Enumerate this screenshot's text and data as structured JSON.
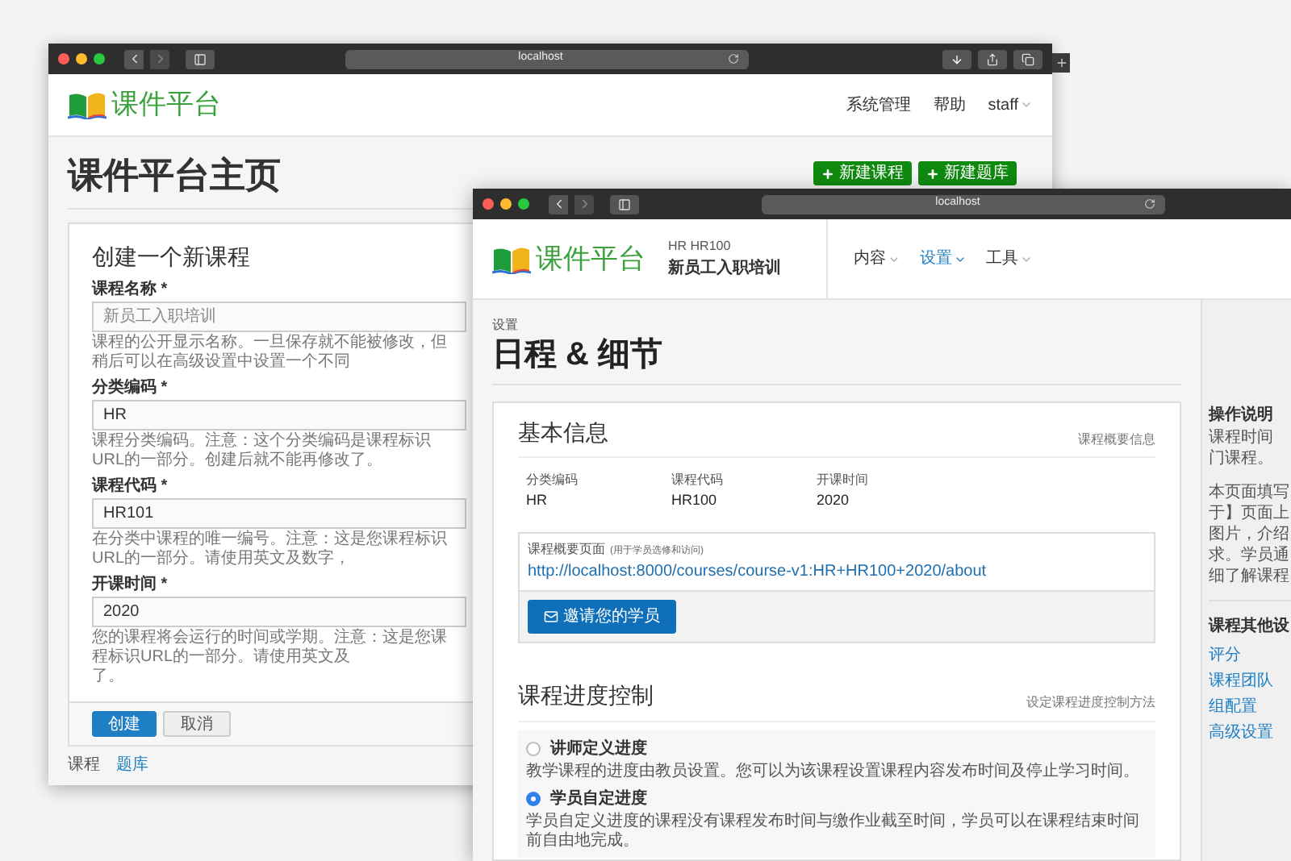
{
  "back_window": {
    "address": "localhost",
    "logo_text": "课件平台",
    "nav": [
      {
        "label": "系统管理",
        "kind": "link"
      },
      {
        "label": "帮助",
        "kind": "link"
      },
      {
        "label": "staff",
        "kind": "menu"
      }
    ],
    "page_title": "课件平台主页",
    "actions": [
      {
        "label": "新建课程"
      },
      {
        "label": "新建题库"
      }
    ],
    "form": {
      "title": "创建一个新课程",
      "fields": [
        {
          "label": "课程名称 *",
          "placeholder": "新员工入职培训",
          "help": [
            "课程的公开显示名称。一旦保存就不能被修改，但稍后可以在高级设置中设置一个不同"
          ]
        },
        {
          "label": "分类编码 *",
          "value": "HR",
          "help": [
            "课程分类编码。注意：这个分类编码是课程标识URL的一部分。创建后就不能再修改了。"
          ]
        },
        {
          "label": "课程代码 *",
          "value": "HR101",
          "help": [
            "在分类中课程的唯一编号。注意：这是您课程标识URL的一部分。请使用英文及数字，"
          ]
        },
        {
          "label": "开课时间 *",
          "value": "2020",
          "help": [
            "您的课程将会运行的时间或学期。注意：这是您课程标识URL的一部分。请使用英文及",
            "了。"
          ]
        }
      ],
      "buttons": [
        {
          "label": "创建",
          "kind": "primary"
        },
        {
          "label": "取消",
          "kind": "secondary"
        }
      ]
    },
    "footer_links": [
      {
        "label": "课程",
        "kind": "text"
      },
      {
        "label": "题库",
        "kind": "link"
      }
    ]
  },
  "front_window": {
    "address": "localhost",
    "logo_text": "课件平台",
    "course": {
      "code": "HR HR100",
      "name": "新员工入职培训"
    },
    "menu": [
      {
        "label": "内容",
        "selected": false
      },
      {
        "label": "设置",
        "selected": true
      },
      {
        "label": "工具",
        "selected": false
      }
    ],
    "breadcrumb": "设置",
    "title": "日程 & 细节",
    "basic_info": {
      "title": "基本信息",
      "aside": "课程概要信息",
      "facts": [
        {
          "label": "分类编码",
          "value": "HR"
        },
        {
          "label": "课程代码",
          "value": "HR100"
        },
        {
          "label": "开课时间",
          "value": "2020"
        }
      ],
      "summary": {
        "label": "课程概要页面",
        "note": "(用于学员选修和访问)",
        "url": "http://localhost:8000/courses/course-v1:HR+HR100+2020/about",
        "button": "邀请您的学员"
      }
    },
    "pacing": {
      "title": "课程进度控制",
      "aside": "设定课程进度控制方法",
      "options": [
        {
          "label": "讲师定义进度",
          "description": "教学课程的进度由教员设置。您可以为该课程设置课程内容发布时间及停止学习时间。",
          "selected": false
        },
        {
          "label": "学员自定进度",
          "description": "学员自定义进度的课程没有课程发布时间与缴作业截至时间，学员可以在课程结束时间前自由地完成。",
          "selected": true
        }
      ]
    },
    "sidebar": {
      "title": "操作说明",
      "lines": [
        "课程时间",
        "门课程。"
      ],
      "lines_2": [
        "本页面填写",
        "于】页面上",
        "图片，介绍",
        "求。学员通",
        "细了解课程"
      ],
      "other_title": "课程其他设",
      "links": [
        "评分",
        "课程团队",
        "组配置",
        "高级设置"
      ]
    }
  }
}
